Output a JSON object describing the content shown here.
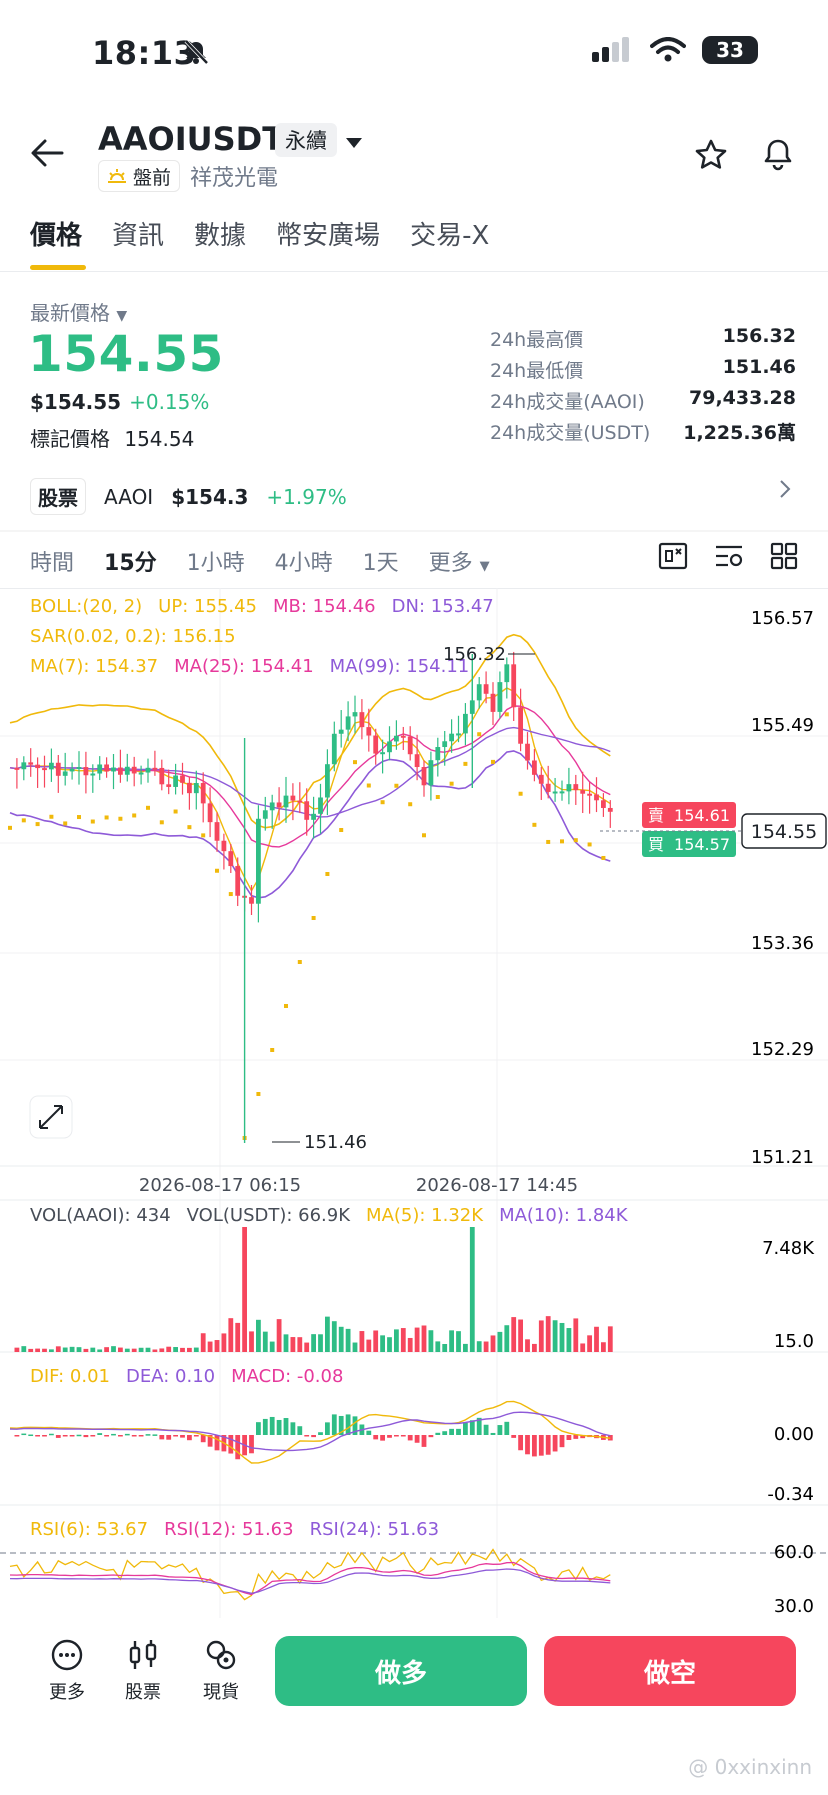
{
  "status": {
    "time": "18:13",
    "battery": "33"
  },
  "header": {
    "symbol": "AAOIUSDT",
    "contract": "永續",
    "pre_tag": "盤前",
    "name": "祥茂光電"
  },
  "tabs": [
    "價格",
    "資訊",
    "數據",
    "幣安廣場",
    "交易-X"
  ],
  "price": {
    "last_label": "最新價格",
    "last": "154.55",
    "usd": "$154.55",
    "change": "+0.15%",
    "mark_label": "標記價格",
    "mark": "154.54"
  },
  "stats": [
    {
      "k": "24h最高價",
      "v": "156.32"
    },
    {
      "k": "24h最低價",
      "v": "151.46"
    },
    {
      "k": "24h成交量(AAOI)",
      "v": "79,433.28"
    },
    {
      "k": "24h成交量(USDT)",
      "v": "1,225.36萬"
    }
  ],
  "stock": {
    "chip": "股票",
    "ticker": "AAOI",
    "price": "$154.3",
    "change": "+1.97%"
  },
  "intervals": [
    "時間",
    "15分",
    "1小時",
    "4小時",
    "1天",
    "更多"
  ],
  "indicators": {
    "boll_label": "BOLL:(20, 2)",
    "boll_up": "UP: 155.45",
    "boll_mb": "MB: 154.46",
    "boll_dn": "DN: 153.47",
    "sar": "SAR(0.02, 0.2): 156.15",
    "ma7": "MA(7): 154.37",
    "ma25": "MA(25): 154.41",
    "ma99": "MA(99): 154.11",
    "vol_aaoi": "VOL(AAOI): 434",
    "vol_usdt": "VOL(USDT): 66.9K",
    "vol_ma5": "MA(5): 1.32K",
    "vol_ma10": "MA(10): 1.84K",
    "dif": "DIF: 0.01",
    "dea": "DEA: 0.10",
    "macd": "MACD: -0.08",
    "rsi6": "RSI(6): 53.67",
    "rsi12": "RSI(12): 51.63",
    "rsi24": "RSI(24): 51.63"
  },
  "chart_axis": {
    "price_ticks": [
      "156.57",
      "155.49",
      "153.36",
      "152.29",
      "151.21"
    ],
    "high_mark": "156.32",
    "low_mark": "151.46",
    "sell_label": "賣",
    "sell_price": "154.61",
    "buy_label": "買",
    "buy_price": "154.57",
    "current": "154.55",
    "dates": [
      "2026-08-17 06:15",
      "2026-08-17 14:45"
    ],
    "vol_ticks": [
      "7.48K",
      "15.0"
    ],
    "macd_ticks": [
      "0.00",
      "-0.34"
    ],
    "rsi_ticks": [
      "60.0",
      "30.0"
    ]
  },
  "colors": {
    "up": "#2ebd85",
    "down": "#f6465d",
    "boll": "#f0b90b",
    "ma25": "#e6399b",
    "ma99": "#8e5ad8"
  },
  "bottom": {
    "more": "更多",
    "stock": "股票",
    "spot": "現貨",
    "long": "做多",
    "short": "做空"
  },
  "watermark": "@ 0xxinxinn"
}
